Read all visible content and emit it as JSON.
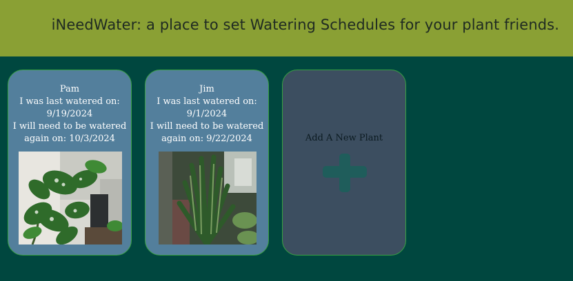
{
  "header": {
    "title": "iNeedWater: a place to set Watering Schedules for your plant friends."
  },
  "plants": [
    {
      "name": "Pam",
      "last_watered_label": "I was last watered on:",
      "last_watered": "9/19/2024",
      "next_watering_label": "I will need to be watered",
      "next_watering": "again on: 10/3/2024"
    },
    {
      "name": "Jim",
      "last_watered_label": "I was last watered on:",
      "last_watered": "9/1/2024",
      "next_watering_label": "I will need to be watered",
      "next_watering": "again on: 9/22/2024"
    }
  ],
  "add_card": {
    "label": "Add A New Plant",
    "icon": "plus-icon"
  },
  "colors": {
    "header_bg": "#8aa034",
    "page_bg": "#00473f",
    "card_bg": "#537f9c",
    "add_card_bg": "#3c4e60",
    "card_border": "#3aa043",
    "plus": "#1f5d5b"
  }
}
